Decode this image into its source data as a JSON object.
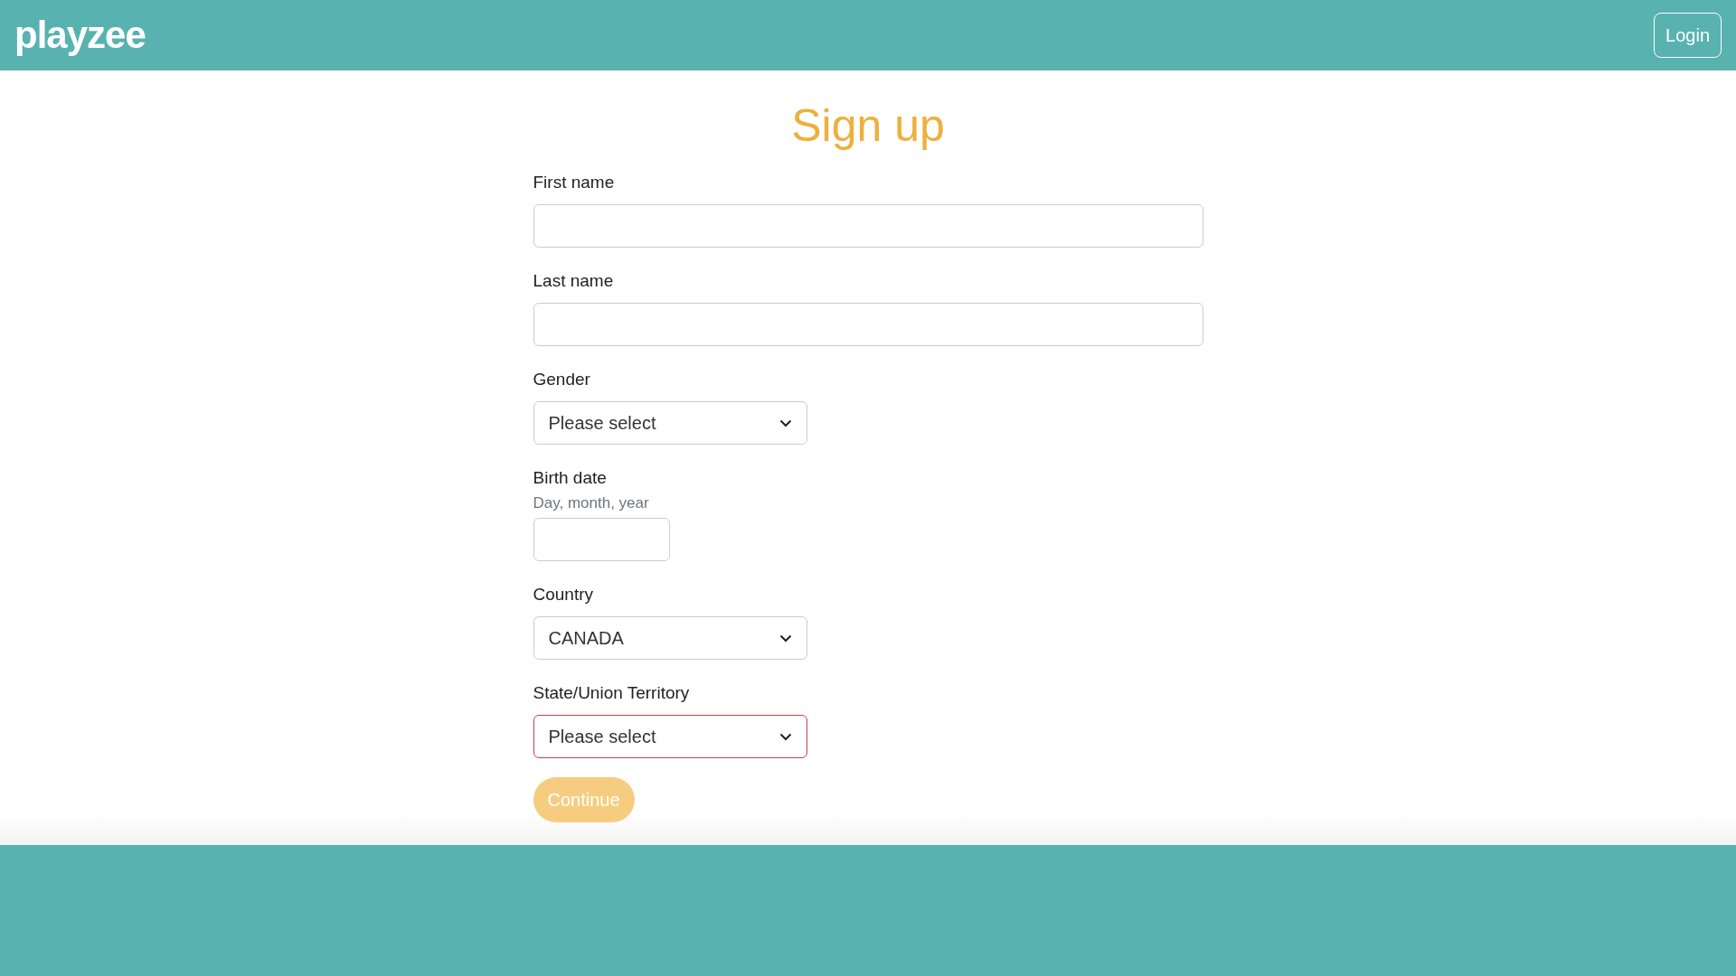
{
  "header": {
    "logo": "playzee",
    "login_button": "Login"
  },
  "title": "Sign up",
  "fields": [
    {
      "kind": "text",
      "label": "First name",
      "invalid": false
    },
    {
      "kind": "text",
      "label": "Last name",
      "invalid": false
    },
    {
      "kind": "select",
      "label": "Gender",
      "value": "Please select",
      "invalid": false
    },
    {
      "kind": "date",
      "label": "Birth date",
      "hint": "Day, month, year",
      "invalid": false
    },
    {
      "kind": "select",
      "label": "Country",
      "value": "CANADA",
      "invalid": false
    },
    {
      "kind": "select",
      "label": "State/Union Territory",
      "value": "Please select",
      "invalid": true
    }
  ],
  "continue_button": {
    "label": "Continue",
    "disabled": true
  }
}
